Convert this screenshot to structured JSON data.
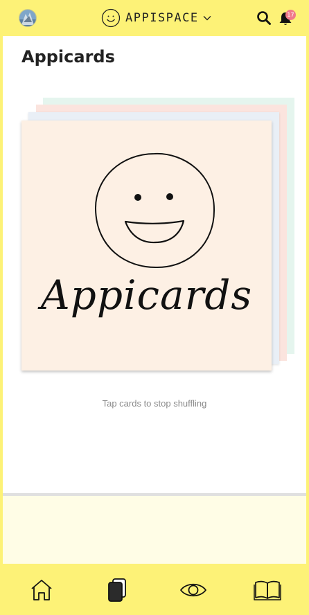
{
  "header": {
    "app_name": "APPISPACE",
    "notification_count": "17",
    "icons": [
      "user-avatar",
      "smiley-logo",
      "chevron-down-icon",
      "search-icon",
      "bell-icon"
    ]
  },
  "page": {
    "title": "Appicards"
  },
  "card": {
    "title": "Appicards",
    "colors": [
      "#fdf0e4",
      "#e9eff6",
      "#fbe4de",
      "#e5f5ee"
    ]
  },
  "hint": "Tap cards to stop shuffling",
  "bottom_nav": {
    "items": [
      {
        "icon": "home-icon"
      },
      {
        "icon": "cards-icon",
        "active": true
      },
      {
        "icon": "eye-icon"
      },
      {
        "icon": "book-icon"
      }
    ]
  },
  "colors": {
    "accent": "#fdf277",
    "lower_background": "#fffde6",
    "badge": "#f07a8a"
  }
}
